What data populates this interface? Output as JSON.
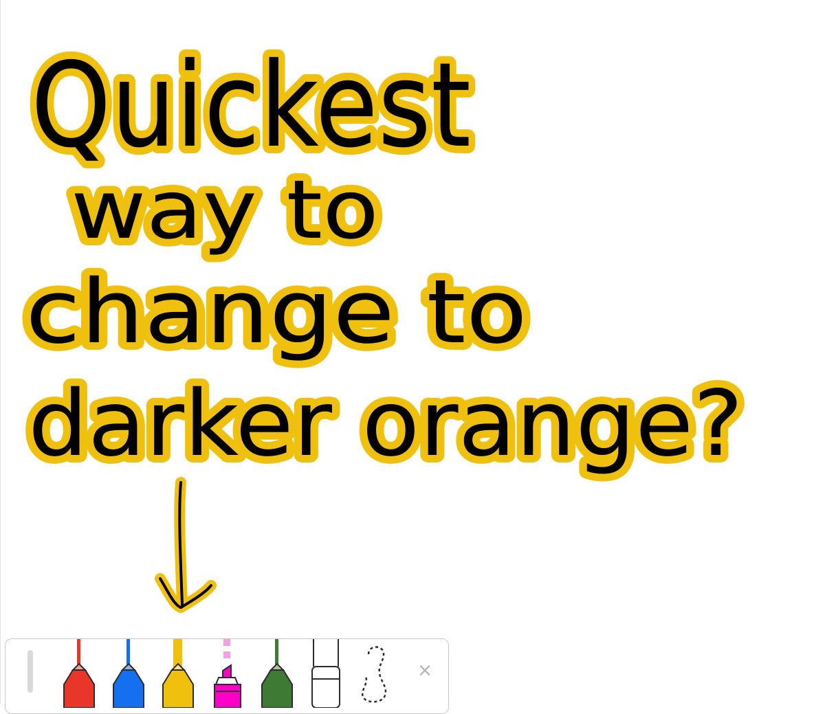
{
  "canvas": {
    "note_lines": [
      "Quickest",
      "way to",
      "change to",
      "darker orange?"
    ],
    "ink_color": "#000000",
    "outline_color": "#f0c00e"
  },
  "toolbar": {
    "tools": [
      {
        "name": "pen-tool-red",
        "color": "#e8372a",
        "icon": "pen-icon"
      },
      {
        "name": "pen-tool-blue",
        "color": "#1570ef",
        "icon": "pen-icon"
      },
      {
        "name": "pen-tool-yellow",
        "color": "#f0c00e",
        "icon": "pen-icon",
        "selected": true
      },
      {
        "name": "highlighter-tool-pink",
        "color": "#ff00c8",
        "icon": "highlighter-icon"
      },
      {
        "name": "pen-tool-green",
        "color": "#3e7a34",
        "icon": "pen-icon"
      },
      {
        "name": "eraser-tool",
        "color": "#ffffff",
        "icon": "eraser-icon"
      },
      {
        "name": "lasso-tool",
        "color": "#000000",
        "icon": "lasso-icon"
      }
    ],
    "close_symbol": "×"
  }
}
